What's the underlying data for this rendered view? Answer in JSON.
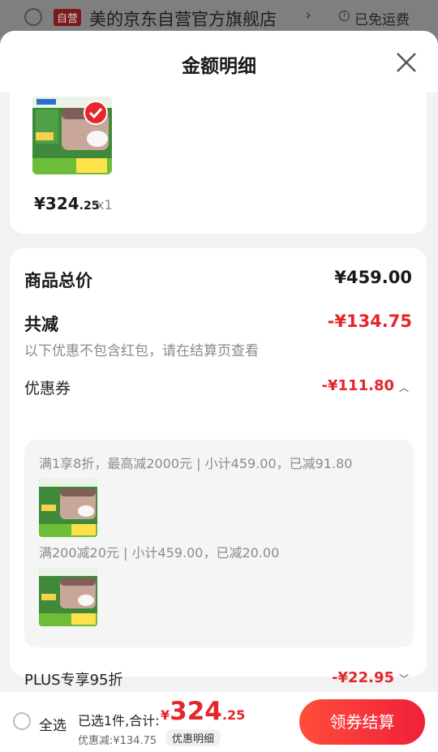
{
  "background_store": {
    "badge": "自营",
    "store_name": "美的京东自营官方旗舰店",
    "chevron": "›",
    "shipping": "已免运费",
    "info_icon": "info-icon"
  },
  "sheet": {
    "title": "金额明细",
    "close_icon": "close-icon"
  },
  "product": {
    "image_icon": "rice-cooker-product-image",
    "price_main": "¥324",
    "price_decimal": ".25",
    "quantity": "x1"
  },
  "summary": {
    "total_label": "商品总价",
    "total_value": "¥459.00",
    "reduce_label": "共减",
    "reduce_value": "-¥134.75",
    "note": "以下优惠不包含红包，请在结算页查看",
    "coupon_label": "优惠券",
    "coupon_value": "-¥111.80",
    "coupon_chevron": "︿",
    "coupons": [
      {
        "text": "满1享8折，最高减2000元 | 小计459.00，已减91.80"
      },
      {
        "text": "满200减20元 | 小计459.00，已减20.00"
      }
    ],
    "plus_label": "PLUS专享95折",
    "plus_value": "-¥22.95",
    "plus_chevron": "﹀"
  },
  "bottom_bar": {
    "select_all": "全选",
    "selected_prefix": "已选1件,合计:",
    "total_currency": "¥",
    "total_int": "324",
    "total_decimal": ".25",
    "discount": "优惠减:¥134.75",
    "detail_chip": "优惠明细",
    "checkout": "领券结算"
  },
  "colors": {
    "accent_red": "#e4262b",
    "checkout_gradient_start": "#ff4e3a",
    "checkout_gradient_end": "#f01f3a"
  }
}
